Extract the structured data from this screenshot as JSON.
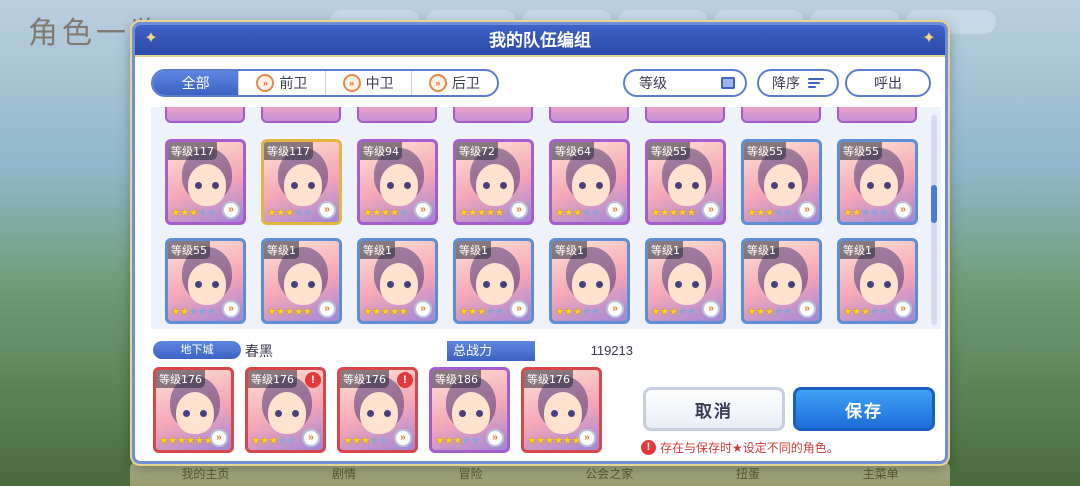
{
  "background": {
    "title": "角色一览",
    "bottom_tabs": [
      "我的主页",
      "剧情",
      "冒险",
      "公会之家",
      "扭蛋",
      "主菜单"
    ]
  },
  "dialog": {
    "title": "我的队伍编组",
    "role_tabs": [
      {
        "label": "全部",
        "icon": "",
        "active": true
      },
      {
        "label": "前卫",
        "icon": "role-chevron-icon",
        "active": false
      },
      {
        "label": "中卫",
        "icon": "role-chevron-icon",
        "active": false
      },
      {
        "label": "后卫",
        "icon": "role-chevron-icon",
        "active": false
      }
    ],
    "sort_level_label": "等级",
    "sort_order_label": "降序",
    "call_out_label": "呼出",
    "roster_row1": [
      {
        "level": "等级117",
        "stars": 3,
        "frame": "purple"
      },
      {
        "level": "等级117",
        "stars": 3,
        "frame": "gold"
      },
      {
        "level": "等级94",
        "stars": 4,
        "frame": "purple"
      },
      {
        "level": "等级72",
        "stars": 5,
        "frame": "purple"
      },
      {
        "level": "等级64",
        "stars": 3,
        "frame": "purple"
      },
      {
        "level": "等级55",
        "stars": 5,
        "frame": "purple"
      },
      {
        "level": "等级55",
        "stars": 3,
        "frame": "blue"
      },
      {
        "level": "等级55",
        "stars": 2,
        "frame": "blue"
      }
    ],
    "roster_row2": [
      {
        "level": "等级55",
        "stars": 2,
        "frame": "blue"
      },
      {
        "level": "等级1",
        "stars": 5,
        "frame": "blue"
      },
      {
        "level": "等级1",
        "stars": 5,
        "frame": "blue"
      },
      {
        "level": "等级1",
        "stars": 3,
        "frame": "blue"
      },
      {
        "level": "等级1",
        "stars": 3,
        "frame": "blue"
      },
      {
        "level": "等级1",
        "stars": 3,
        "frame": "blue"
      },
      {
        "level": "等级1",
        "stars": 3,
        "frame": "blue"
      },
      {
        "level": "等级1",
        "stars": 3,
        "frame": "blue"
      }
    ],
    "team_tag": "地下城",
    "team_name": "春黑",
    "power_label": "总战力",
    "power_value": "119213",
    "team": [
      {
        "level": "等级176",
        "stars": 6,
        "frame": "red",
        "warn": false
      },
      {
        "level": "等级176",
        "stars": 3,
        "frame": "red",
        "warn": true
      },
      {
        "level": "等级176",
        "stars": 3,
        "frame": "red",
        "warn": true
      },
      {
        "level": "等级186",
        "stars": 3,
        "frame": "purple",
        "warn": false
      },
      {
        "level": "等级176",
        "stars": 6,
        "frame": "red",
        "warn": false
      }
    ],
    "cancel_label": "取消",
    "save_label": "保存",
    "notice_text": "存在与保存时★设定不同的角色。"
  }
}
